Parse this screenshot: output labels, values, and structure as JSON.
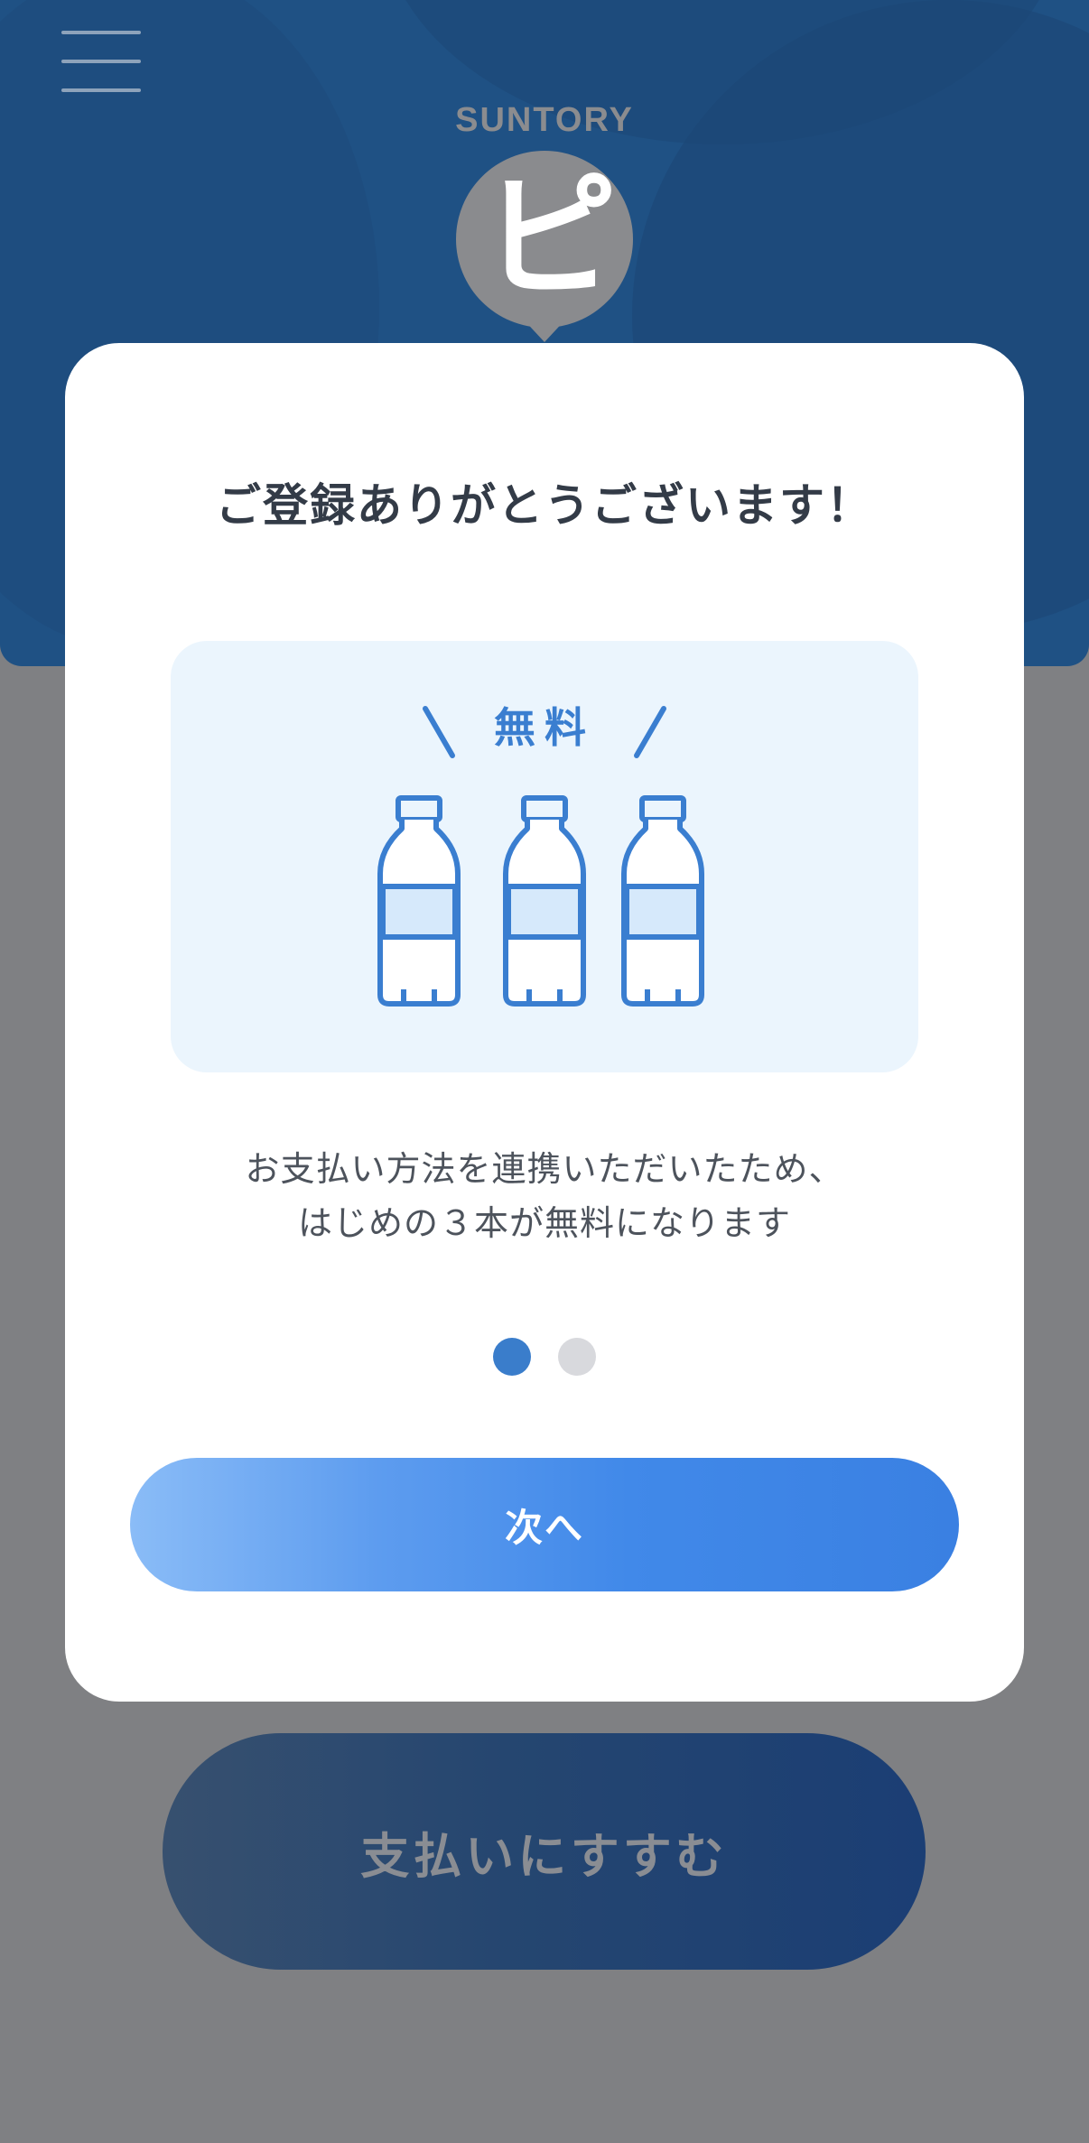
{
  "header": {
    "brand": "SUNTORY",
    "logo_glyph": "ピ",
    "menu_icon": "hamburger-menu-icon"
  },
  "background_cta": {
    "label": "支払いにすすむ"
  },
  "modal": {
    "title": "ご登録ありがとうございます！",
    "illustration": {
      "label": "無料",
      "bottle_icon": "bottle-icon",
      "bottle_count": 3
    },
    "description_line1": "お支払い方法を連携いただいたため、",
    "description_line2": "はじめの３本が無料になります",
    "pager": {
      "pages": 2,
      "active": 1
    },
    "next_label": "次へ"
  },
  "colors": {
    "header_bg": "#1f5184",
    "overlay_bg": "#7f8083",
    "accent": "#3a7ed0",
    "button_gradient_start": "#8abcf7",
    "button_gradient_end": "#3a80e2"
  }
}
